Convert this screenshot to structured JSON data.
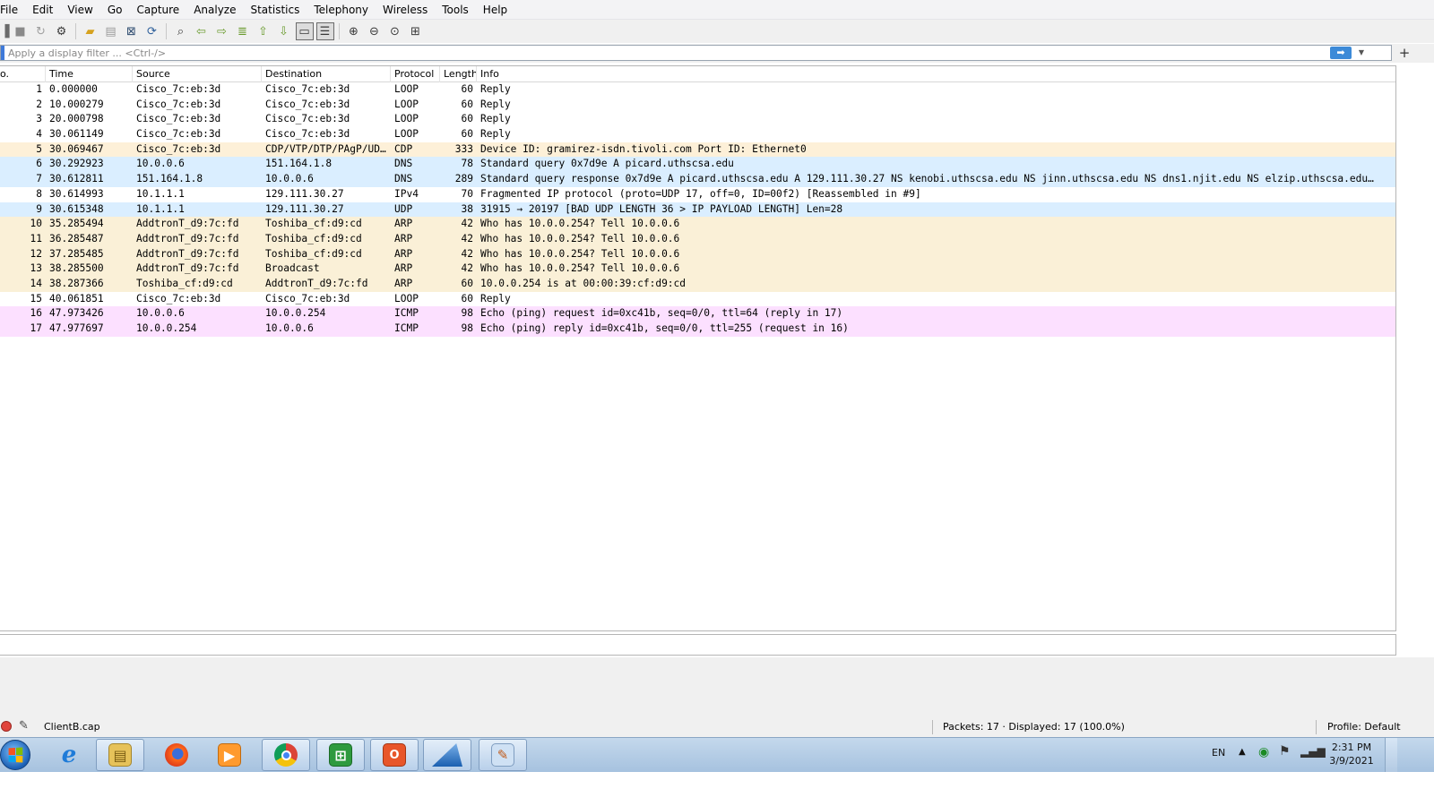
{
  "menu": [
    "File",
    "Edit",
    "View",
    "Go",
    "Capture",
    "Analyze",
    "Statistics",
    "Telephony",
    "Wireless",
    "Tools",
    "Help"
  ],
  "toolbar_icons": [
    "start-capture-icon",
    "stop-capture-icon",
    "restart-capture-icon",
    "capture-options-icon",
    "open-file-icon",
    "save-file-icon",
    "close-file-icon",
    "reload-file-icon",
    "find-packet-icon",
    "go-back-icon",
    "go-forward-icon",
    "go-to-packet-icon",
    "go-first-icon",
    "go-last-icon",
    "autoscroll-icon",
    "colorize-icon",
    "zoom-in-icon",
    "zoom-out-icon",
    "zoom-normal-icon",
    "resize-columns-icon"
  ],
  "filter": {
    "placeholder": "Apply a display filter ... <Ctrl-/>",
    "value": ""
  },
  "columns": {
    "no": "o.",
    "time": "Time",
    "source": "Source",
    "destination": "Destination",
    "protocol": "Protocol",
    "length": "Length",
    "info": "Info"
  },
  "packets": [
    {
      "no": "1",
      "time": "0.000000",
      "source": "Cisco_7c:eb:3d",
      "destination": "Cisco_7c:eb:3d",
      "protocol": "LOOP",
      "length": "60",
      "info": "Reply",
      "color": "loop"
    },
    {
      "no": "2",
      "time": "10.000279",
      "source": "Cisco_7c:eb:3d",
      "destination": "Cisco_7c:eb:3d",
      "protocol": "LOOP",
      "length": "60",
      "info": "Reply",
      "color": "loop"
    },
    {
      "no": "3",
      "time": "20.000798",
      "source": "Cisco_7c:eb:3d",
      "destination": "Cisco_7c:eb:3d",
      "protocol": "LOOP",
      "length": "60",
      "info": "Reply",
      "color": "loop"
    },
    {
      "no": "4",
      "time": "30.061149",
      "source": "Cisco_7c:eb:3d",
      "destination": "Cisco_7c:eb:3d",
      "protocol": "LOOP",
      "length": "60",
      "info": "Reply",
      "color": "loop"
    },
    {
      "no": "5",
      "time": "30.069467",
      "source": "Cisco_7c:eb:3d",
      "destination": "CDP/VTP/DTP/PAgP/UD…",
      "protocol": "CDP",
      "length": "333",
      "info": "Device ID: gramirez-isdn.tivoli.com  Port ID: Ethernet0",
      "color": "cdp"
    },
    {
      "no": "6",
      "time": "30.292923",
      "source": "10.0.0.6",
      "destination": "151.164.1.8",
      "protocol": "DNS",
      "length": "78",
      "info": "Standard query 0x7d9e A picard.uthscsa.edu",
      "color": "dns"
    },
    {
      "no": "7",
      "time": "30.612811",
      "source": "151.164.1.8",
      "destination": "10.0.0.6",
      "protocol": "DNS",
      "length": "289",
      "info": "Standard query response 0x7d9e A picard.uthscsa.edu A 129.111.30.27 NS kenobi.uthscsa.edu NS jinn.uthscsa.edu NS dns1.njit.edu NS elzip.uthscsa.edu…",
      "color": "dns"
    },
    {
      "no": "8",
      "time": "30.614993",
      "source": "10.1.1.1",
      "destination": "129.111.30.27",
      "protocol": "IPv4",
      "length": "70",
      "info": "Fragmented IP protocol (proto=UDP 17, off=0, ID=00f2) [Reassembled in #9]",
      "color": "ipv4"
    },
    {
      "no": "9",
      "time": "30.615348",
      "source": "10.1.1.1",
      "destination": "129.111.30.27",
      "protocol": "UDP",
      "length": "38",
      "info": "31915 → 20197 [BAD UDP LENGTH 36 > IP PAYLOAD LENGTH] Len=28",
      "color": "udp"
    },
    {
      "no": "10",
      "time": "35.285494",
      "source": "AddtronT_d9:7c:fd",
      "destination": "Toshiba_cf:d9:cd",
      "protocol": "ARP",
      "length": "42",
      "info": "Who has 10.0.0.254? Tell 10.0.0.6",
      "color": "arp"
    },
    {
      "no": "11",
      "time": "36.285487",
      "source": "AddtronT_d9:7c:fd",
      "destination": "Toshiba_cf:d9:cd",
      "protocol": "ARP",
      "length": "42",
      "info": "Who has 10.0.0.254? Tell 10.0.0.6",
      "color": "arp"
    },
    {
      "no": "12",
      "time": "37.285485",
      "source": "AddtronT_d9:7c:fd",
      "destination": "Toshiba_cf:d9:cd",
      "protocol": "ARP",
      "length": "42",
      "info": "Who has 10.0.0.254? Tell 10.0.0.6",
      "color": "arp"
    },
    {
      "no": "13",
      "time": "38.285500",
      "source": "AddtronT_d9:7c:fd",
      "destination": "Broadcast",
      "protocol": "ARP",
      "length": "42",
      "info": "Who has 10.0.0.254? Tell 10.0.0.6",
      "color": "arp"
    },
    {
      "no": "14",
      "time": "38.287366",
      "source": "Toshiba_cf:d9:cd",
      "destination": "AddtronT_d9:7c:fd",
      "protocol": "ARP",
      "length": "60",
      "info": "10.0.0.254 is at 00:00:39:cf:d9:cd",
      "color": "arp"
    },
    {
      "no": "15",
      "time": "40.061851",
      "source": "Cisco_7c:eb:3d",
      "destination": "Cisco_7c:eb:3d",
      "protocol": "LOOP",
      "length": "60",
      "info": "Reply",
      "color": "loop"
    },
    {
      "no": "16",
      "time": "47.973426",
      "source": "10.0.0.6",
      "destination": "10.0.0.254",
      "protocol": "ICMP",
      "length": "98",
      "info": "Echo (ping) request  id=0xc41b, seq=0/0, ttl=64 (reply in 17)",
      "color": "icmp"
    },
    {
      "no": "17",
      "time": "47.977697",
      "source": "10.0.0.254",
      "destination": "10.0.0.6",
      "protocol": "ICMP",
      "length": "98",
      "info": "Echo (ping) reply    id=0xc41b, seq=0/0, ttl=255 (request in 16)",
      "color": "icmp"
    }
  ],
  "status": {
    "file": "ClientB.cap",
    "packets": "Packets: 17 · Displayed: 17 (100.0%)",
    "profile": "Profile: Default"
  },
  "taskbar": {
    "apps": [
      {
        "name": "internet-explorer-icon",
        "open": false
      },
      {
        "name": "file-explorer-icon",
        "open": true
      },
      {
        "name": "firefox-icon",
        "open": false
      },
      {
        "name": "media-player-icon",
        "open": false
      },
      {
        "name": "chrome-icon",
        "open": true
      },
      {
        "name": "remote-desktop-icon",
        "open": true
      },
      {
        "name": "office-icon",
        "open": true
      },
      {
        "name": "wireshark-icon",
        "open": true
      },
      {
        "name": "paint-icon",
        "open": true
      }
    ],
    "lang": "EN",
    "time": "2:31 PM",
    "date": "3/9/2021"
  }
}
